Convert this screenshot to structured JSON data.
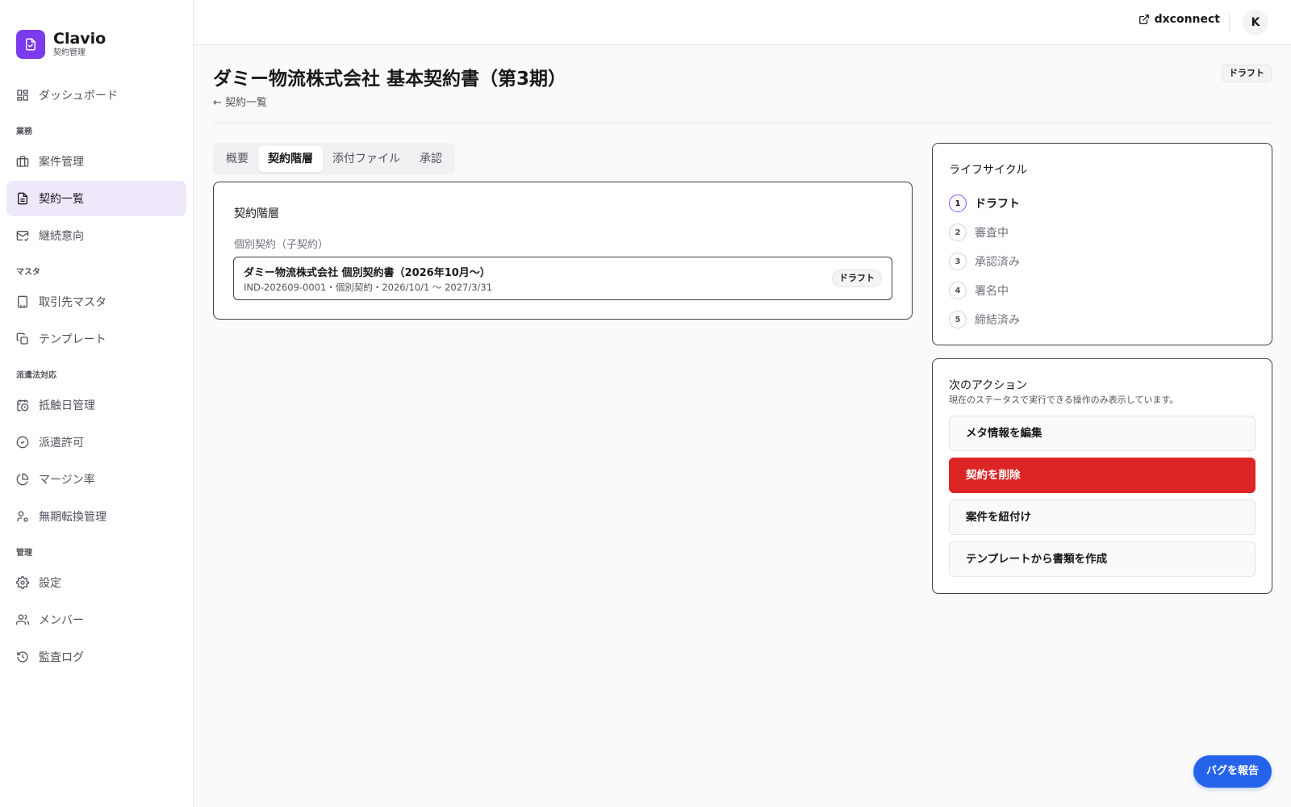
{
  "brand": {
    "name": "Clavio",
    "subtitle": "契約管理"
  },
  "sidebar": {
    "dashboard": "ダッシュボード",
    "sections": {
      "business": "業務",
      "master": "マスタ",
      "dispatch": "派遣法対応",
      "admin": "管理"
    },
    "items": {
      "projects": "案件管理",
      "contracts": "契約一覧",
      "renewal": "継続意向",
      "partners": "取引先マスタ",
      "templates": "テンプレート",
      "conflict": "抵触日管理",
      "permit": "派遣許可",
      "margin": "マージン率",
      "indefinite": "無期転換管理",
      "settings": "設定",
      "members": "メンバー",
      "audit": "監査ログ"
    }
  },
  "header": {
    "external_link": "dxconnect",
    "avatar_initial": "K"
  },
  "page": {
    "title": "ダミー物流株式会社 基本契約書（第3期）",
    "back": "← 契約一覧",
    "status": "ドラフト"
  },
  "tabs": [
    "概要",
    "契約階層",
    "添付ファイル",
    "承認"
  ],
  "hierarchy": {
    "heading": "契約階層",
    "sub_heading": "個別契約（子契約）",
    "child": {
      "title": "ダミー物流株式会社 個別契約書（2026年10月～）",
      "meta": "IND-202609-0001・個別契約・2026/10/1 ～ 2027/3/31",
      "status": "ドラフト"
    }
  },
  "lifecycle": {
    "heading": "ライフサイクル",
    "steps": [
      {
        "num": "1",
        "label": "ドラフト"
      },
      {
        "num": "2",
        "label": "審査中"
      },
      {
        "num": "3",
        "label": "承認済み"
      },
      {
        "num": "4",
        "label": "署名中"
      },
      {
        "num": "5",
        "label": "締結済み"
      }
    ]
  },
  "actions": {
    "heading": "次のアクション",
    "description": "現在のステータスで実行できる操作のみ表示しています。",
    "edit_meta": "メタ情報を編集",
    "delete": "契約を削除",
    "link_project": "案件を紐付け",
    "create_from_template": "テンプレートから書類を作成"
  },
  "bug_report": "バグを報告",
  "colors": {
    "accent": "#7c3aed",
    "danger": "#dc2626",
    "primary_blue": "#2563eb"
  }
}
